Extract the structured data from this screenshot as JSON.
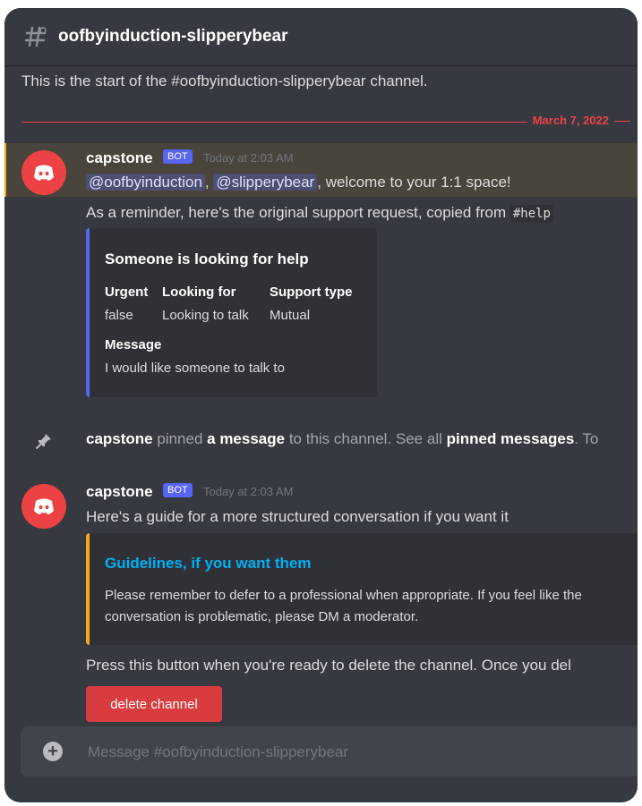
{
  "header": {
    "channel_name": "oofbyinduction-slipperybear"
  },
  "channel_start": "This is the start of the #oofbyinduction-slipperybear channel.",
  "date_divider": "March 7, 2022",
  "messages": [
    {
      "author": "capstone",
      "bot_tag": "BOT",
      "timestamp": "Today at 2:03 AM",
      "mention_1": "@oofbyinduction",
      "separator": ",",
      "mention_2": "@slipperybear",
      "welcome_text": ", welcome to your 1:1 space!",
      "reminder_text": "As a reminder, here's the original support request, copied from",
      "reminder_code": "#help",
      "embed": {
        "title": "Someone is looking for help",
        "fields": [
          {
            "name": "Urgent",
            "value": "false"
          },
          {
            "name": "Looking for",
            "value": "Looking to talk"
          },
          {
            "name": "Support type",
            "value": "Mutual"
          }
        ],
        "message_name": "Message",
        "message_value": "I would like someone to talk to",
        "accent_color": "#5865f2"
      }
    },
    {
      "author": "capstone",
      "bot_tag": "BOT",
      "timestamp": "Today at 2:03 AM",
      "text": "Here's a guide for a more structured conversation if you want it",
      "embed": {
        "title": "Guidelines, if you want them",
        "desc_line_1": "Please remember to defer to a professional when appropriate. If you feel like the",
        "desc_line_2": "conversation is problematic, please DM a moderator.",
        "accent_color": "#faa81a"
      },
      "delete_text": "Press this button when you're ready to delete the channel. Once you del",
      "button_label": "delete channel"
    }
  ],
  "pin_notice": {
    "author": "capstone",
    "pinned": " pinned ",
    "link_1": "a message",
    "middle": " to this channel. See all ",
    "link_2": "pinned messages",
    "tail": ". To"
  },
  "composer": {
    "placeholder": "Message #oofbyinduction-slipperybear",
    "icon": "plus-circle-icon"
  },
  "colors": {
    "background": "#36393f",
    "mention_highlight": "#49443c",
    "danger": "#d83c3e",
    "bot_tag": "#5865f2",
    "link": "#00aff4"
  }
}
